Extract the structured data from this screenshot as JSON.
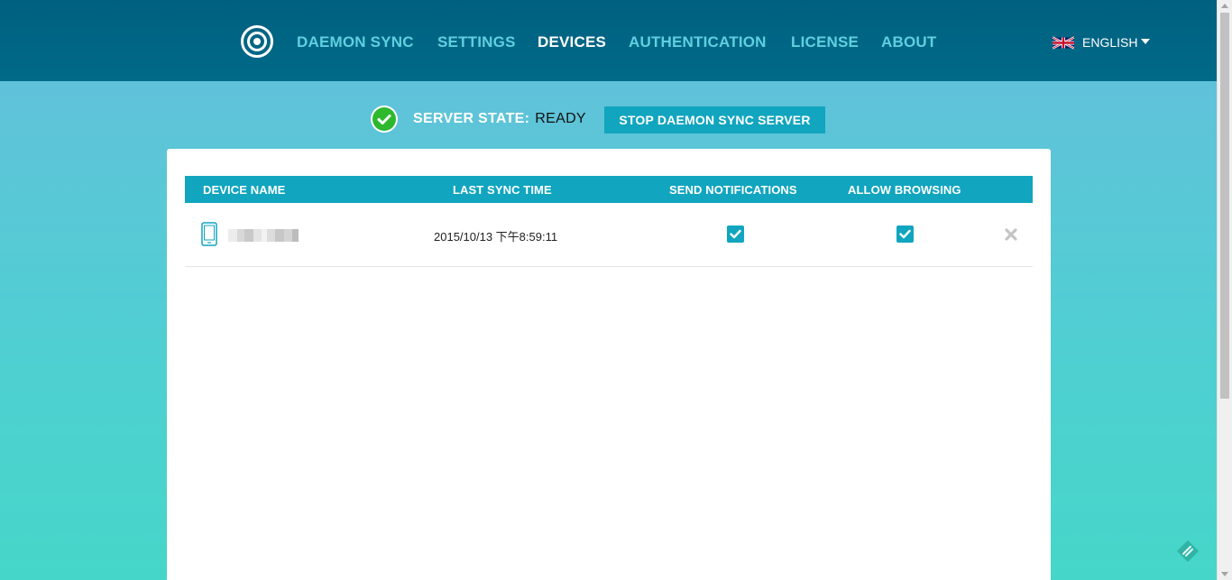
{
  "nav": {
    "items": [
      {
        "label": "DAEMON SYNC",
        "active": false
      },
      {
        "label": "SETTINGS",
        "active": false
      },
      {
        "label": "DEVICES",
        "active": true
      },
      {
        "label": "AUTHENTICATION",
        "active": false
      },
      {
        "label": "LICENSE",
        "active": false
      },
      {
        "label": "ABOUT",
        "active": false
      }
    ],
    "language": "ENGLISH"
  },
  "server": {
    "state_label": "SERVER STATE:",
    "state_value": "READY",
    "stop_button": "STOP DAEMON SYNC SERVER"
  },
  "table": {
    "headers": [
      "DEVICE NAME",
      "LAST SYNC TIME",
      "SEND NOTIFICATIONS",
      "ALLOW BROWSING"
    ],
    "rows": [
      {
        "device_icon": "phone-icon",
        "device_name": "",
        "last_sync_time": "2015/10/13 下午8:59:11",
        "send_notifications": true,
        "allow_browsing": true
      }
    ]
  },
  "colors": {
    "header_bg": "#006a89",
    "accent": "#11a5bf",
    "nav_inactive": "#5fd0e0",
    "nav_active": "#ffffff",
    "ok_green": "#2eb82e"
  }
}
